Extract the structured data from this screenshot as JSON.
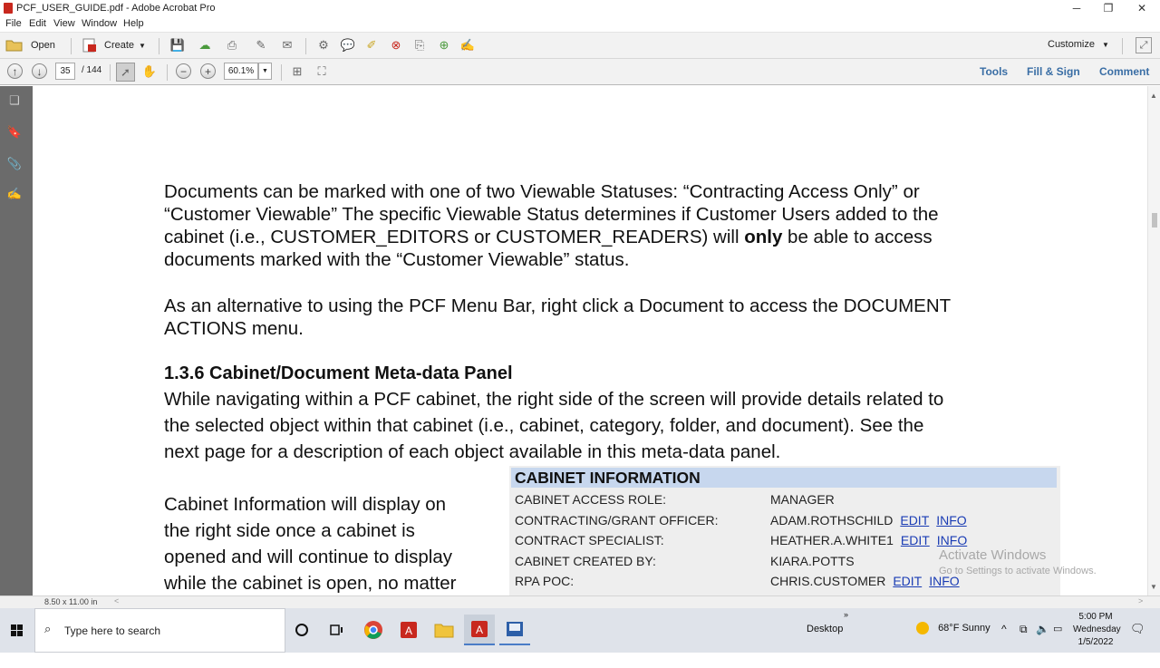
{
  "window": {
    "title": "PCF_USER_GUIDE.pdf - Adobe Acrobat Pro"
  },
  "menu": [
    "File",
    "Edit",
    "View",
    "Window",
    "Help"
  ],
  "toolbar": {
    "open_label": "Open",
    "create_label": "Create",
    "customize_label": "Customize"
  },
  "nav": {
    "current_page": "35",
    "total_pages": "/ 144",
    "zoom": "60.1%"
  },
  "right_links": {
    "tools": "Tools",
    "fill_sign": "Fill & Sign",
    "comment": "Comment"
  },
  "document": {
    "para1_lines": [
      "Documents can be marked with one of two Viewable Statuses: “Contracting Access Only” or",
      "“Customer Viewable”   The specific Viewable Status determines if Customer Users added to the",
      "cabinet (i.e., CUSTOMER_EDITORS or CUSTOMER_READERS) will ",
      "only",
      " be able to access",
      "documents marked with the “Customer Viewable” status."
    ],
    "para2_lines": [
      "As an alternative to using the PCF Menu Bar, right click a Document to access the DOCUMENT",
      "ACTIONS menu."
    ],
    "heading": "1.3.6 Cabinet/Document Meta-data Panel",
    "para3_lines": [
      "While navigating within a PCF cabinet, the right side of the screen will provide details related to",
      "the selected object within that cabinet (i.e., cabinet, category, folder, and document).   See the",
      "next page for a description of each object available in this meta-data panel."
    ],
    "para4_lines": [
      "Cabinet Information will display on",
      "the right side once a cabinet is",
      "opened and will continue to display",
      "while the cabinet is open, no matter"
    ],
    "cabinet": {
      "title": "CABINET INFORMATION",
      "rows": [
        {
          "label": "CABINET ACCESS ROLE:",
          "value": "MANAGER",
          "edit": "",
          "info": ""
        },
        {
          "label": "CONTRACTING/GRANT OFFICER:",
          "value": "ADAM.ROTHSCHILD",
          "edit": "EDIT",
          "info": "INFO"
        },
        {
          "label": "CONTRACT SPECIALIST:",
          "value": "HEATHER.A.WHITE1",
          "edit": "EDIT",
          "info": "INFO"
        },
        {
          "label": "CABINET CREATED BY:",
          "value": "KIARA.POTTS",
          "edit": "",
          "info": ""
        },
        {
          "label": "RPA POC:",
          "value": "CHRIS.CUSTOMER",
          "edit": "EDIT",
          "info": "INFO"
        }
      ]
    }
  },
  "watermark": {
    "line1": "Activate Windows",
    "line2": "Go to Settings to activate Windows."
  },
  "status": {
    "page_size": "8.50 x 11.00 in"
  },
  "taskbar": {
    "search_placeholder": "Type here to search",
    "desktop_label": "Desktop",
    "weather": "68°F  Sunny",
    "time": "5:00 PM",
    "day": "Wednesday",
    "date": "1/5/2022"
  }
}
